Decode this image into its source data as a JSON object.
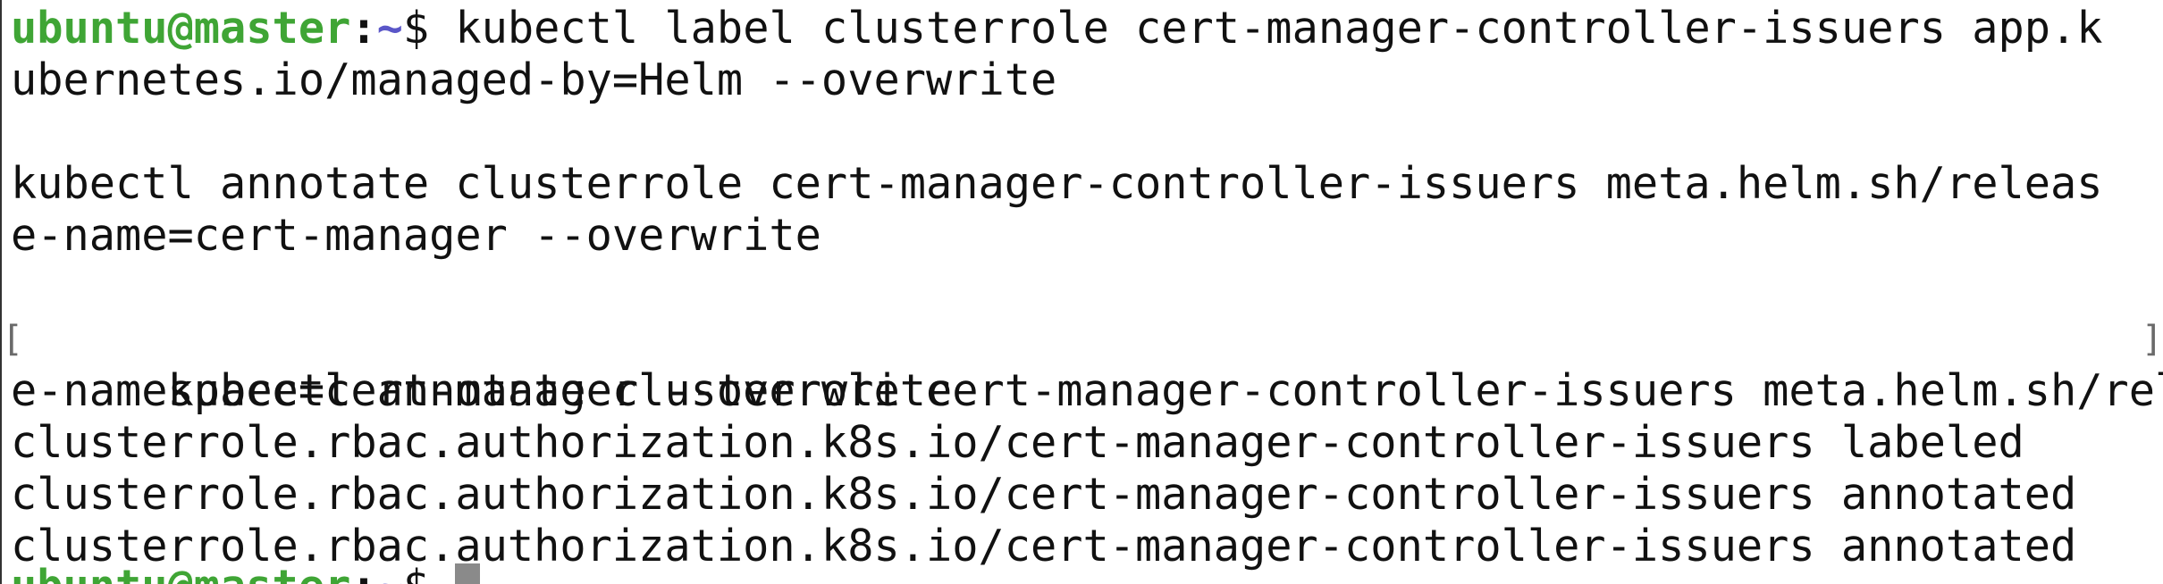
{
  "terminal": {
    "prompt": {
      "user_host": "ubuntu@master",
      "colon": ":",
      "path": "~",
      "symbol": "$ "
    },
    "lines": {
      "l1_cmd": "kubectl label clusterrole cert-manager-controller-issuers app.k",
      "l2": "ubernetes.io/managed-by=Helm --overwrite",
      "l3": "",
      "l4": "kubectl annotate clusterrole cert-manager-controller-issuers meta.helm.sh/releas",
      "l5": "e-name=cert-manager --overwrite",
      "l6": "",
      "l7": "kubectl annotate clusterrole cert-manager-controller-issuers meta.helm.sh/releas",
      "l8": "e-namespace=cert-manager --overwrite",
      "l9": "clusterrole.rbac.authorization.k8s.io/cert-manager-controller-issuers labeled",
      "l10": "clusterrole.rbac.authorization.k8s.io/cert-manager-controller-issuers annotated",
      "l11": "clusterrole.rbac.authorization.k8s.io/cert-manager-controller-issuers annotated"
    },
    "brackets": {
      "left": "[",
      "right": "]"
    }
  }
}
